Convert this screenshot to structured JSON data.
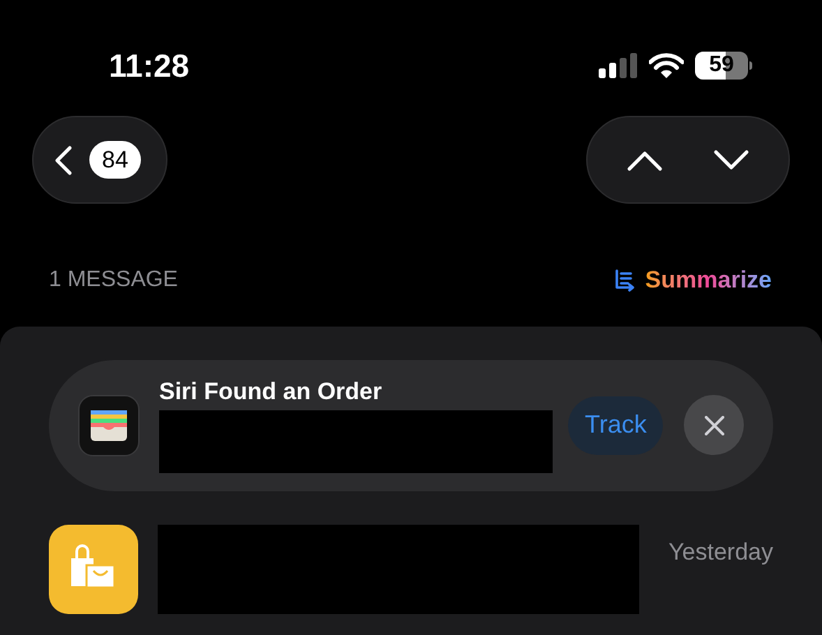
{
  "status_bar": {
    "time": "11:28",
    "battery": "59"
  },
  "nav": {
    "unread_count": "84"
  },
  "header": {
    "count_label": "1 MESSAGE",
    "summarize": "Summarize"
  },
  "siri_card": {
    "title": "Siri Found an Order",
    "action": "Track"
  },
  "message": {
    "time": "Yesterday"
  }
}
